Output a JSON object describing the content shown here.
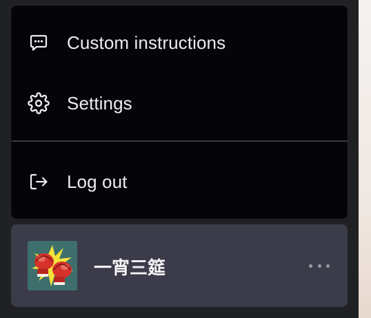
{
  "menu": {
    "custom_instructions": {
      "label": "Custom instructions",
      "icon": "chat-bubble-icon"
    },
    "settings": {
      "label": "Settings",
      "icon": "gear-icon"
    },
    "logout": {
      "label": "Log out",
      "icon": "logout-icon"
    }
  },
  "user": {
    "name": "一宵三筵",
    "avatar_icon": "boxing-gloves-avatar",
    "more_icon": "ellipsis-icon"
  },
  "colors": {
    "sidebar_bg": "#202123",
    "menu_bg": "#050509",
    "user_row_bg": "#3b3b49",
    "text": "#ececf1"
  }
}
